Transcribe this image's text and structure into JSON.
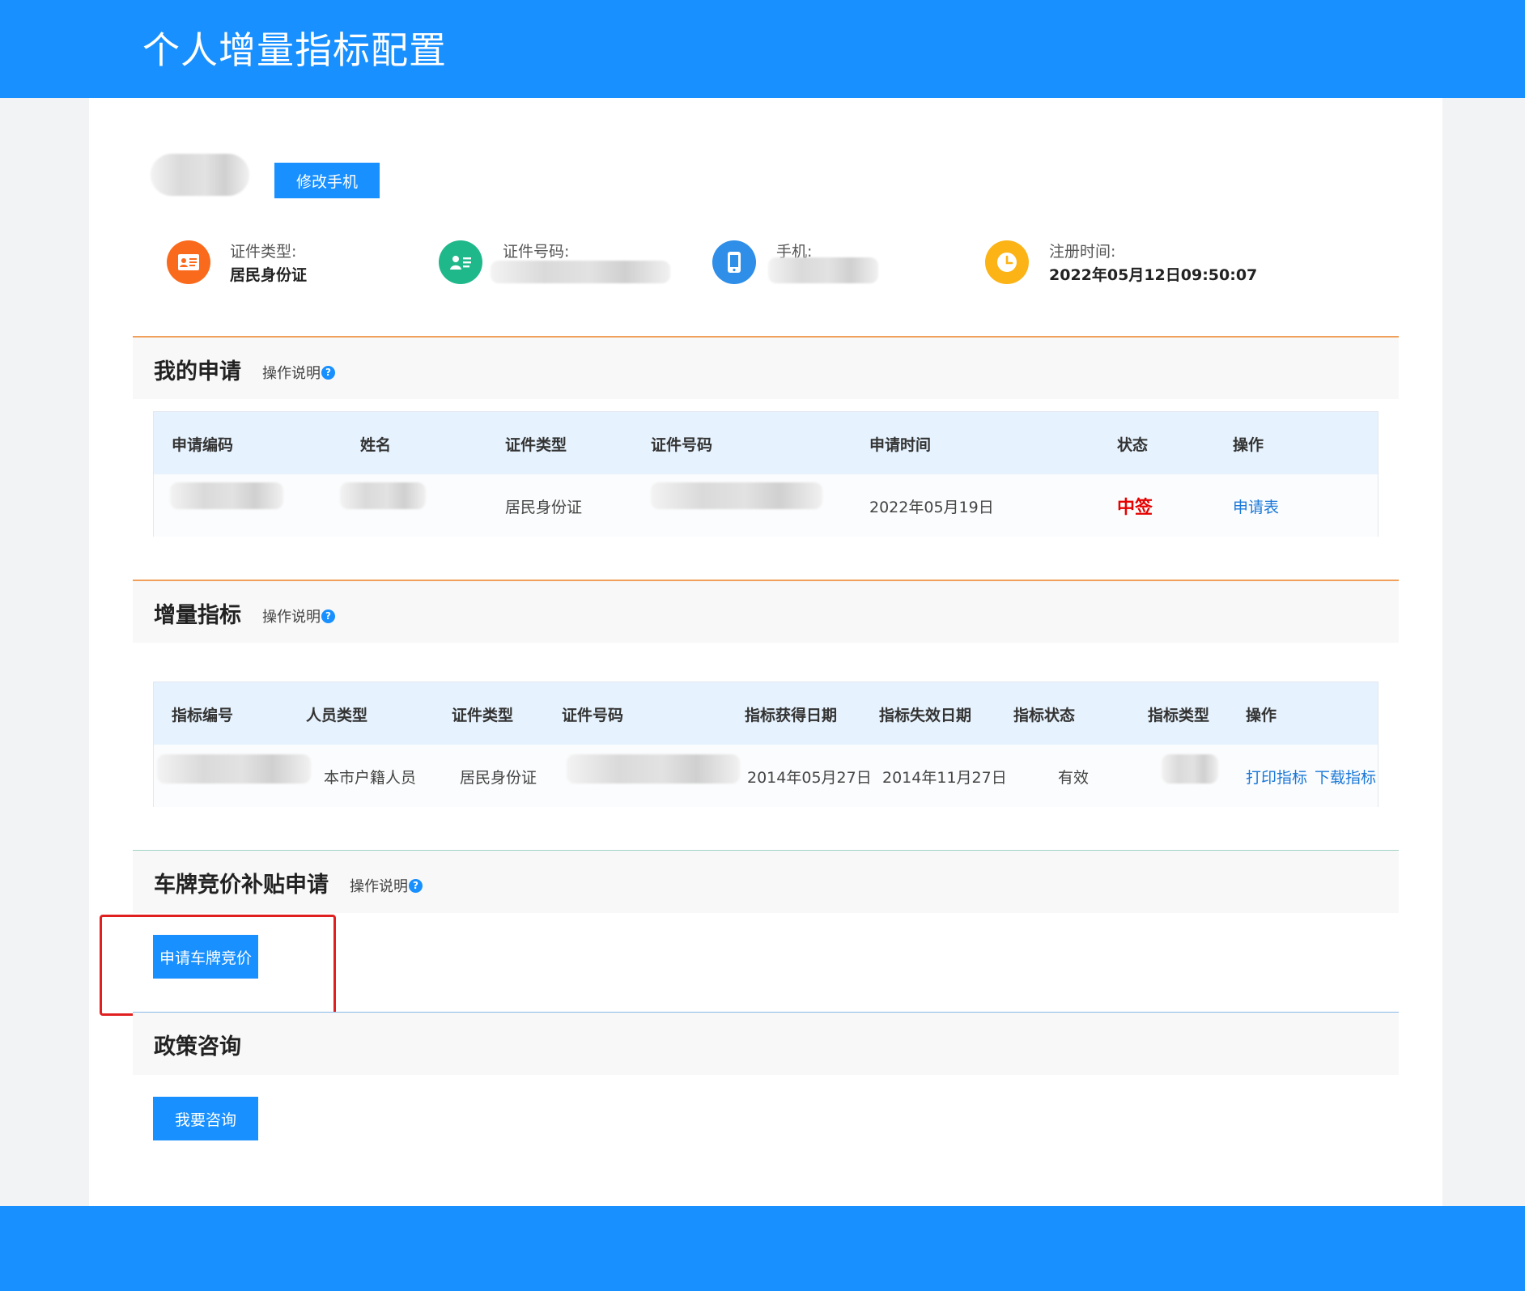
{
  "header": {
    "title": "个人增量指标配置"
  },
  "profile": {
    "edit_phone_button": "修改手机",
    "fields": [
      {
        "label": "证件类型:",
        "value": "居民身份证",
        "icon": "id-card-icon",
        "color": "#fa6a1c"
      },
      {
        "label": "证件号码:",
        "value": "",
        "icon": "contact-card-icon",
        "color": "#1fb88a"
      },
      {
        "label": "手机:",
        "value": "",
        "icon": "mobile-phone-icon",
        "color": "#2e8ee8"
      },
      {
        "label": "注册时间:",
        "value": "2022年05月12日09:50:07",
        "icon": "clock-icon",
        "color": "#fbb316"
      }
    ]
  },
  "applications": {
    "title": "我的申请",
    "help": "操作说明",
    "columns": [
      "申请编码",
      "姓名",
      "证件类型",
      "证件号码",
      "申请时间",
      "状态",
      "操作"
    ],
    "rows": [
      {
        "id_type": "居民身份证",
        "time": "2022年05月19日",
        "status": "中签",
        "action": "申请表"
      }
    ]
  },
  "quota": {
    "title": "增量指标",
    "help": "操作说明",
    "columns": [
      "指标编号",
      "人员类型",
      "证件类型",
      "证件号码",
      "指标获得日期",
      "指标失效日期",
      "指标状态",
      "指标类型",
      "操作"
    ],
    "rows": [
      {
        "person_type": "本市户籍人员",
        "id_type": "居民身份证",
        "obtain_date": "2014年05月27日",
        "expire_date": "2014年11月27日",
        "status": "有效",
        "action_print": "打印指标",
        "action_download": "下载指标"
      }
    ]
  },
  "subsidy": {
    "title": "车牌竞价补贴申请",
    "help": "操作说明",
    "apply_button": "申请车牌竞价"
  },
  "policy": {
    "title": "政策咨询",
    "consult_button": "我要咨询"
  },
  "colors": {
    "brand": "#1890ff",
    "status_red": "#e60000",
    "link": "#1a78d8"
  }
}
